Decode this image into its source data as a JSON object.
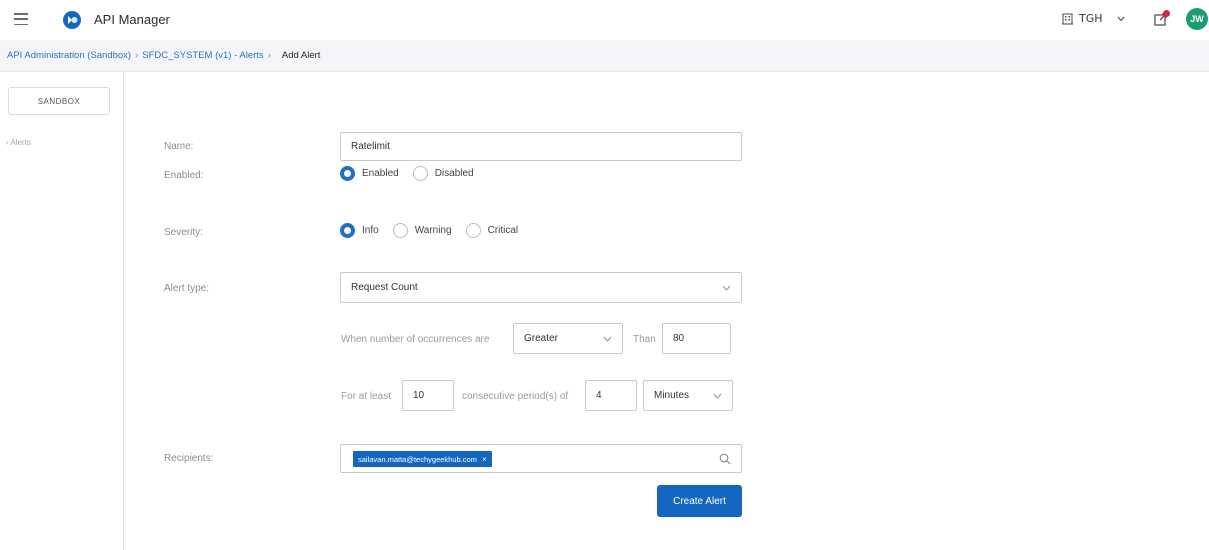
{
  "header": {
    "title": "API Manager",
    "org": "TGH",
    "avatar_initials": "JW",
    "accent_color": "#1566c0",
    "avatar_color": "#1a9e6f",
    "notification_color": "#d8213b"
  },
  "breadcrumb": {
    "items": [
      "API Administration (Sandbox)",
      "SFDC_SYSTEM (v1) - Alerts"
    ],
    "current": "Add Alert"
  },
  "sidebar": {
    "environment": "SANDBOX",
    "items": [
      "Alerts"
    ]
  },
  "form": {
    "name": {
      "label": "Name:",
      "value": "Ratelimit"
    },
    "enabled": {
      "label": "Enabled:",
      "options": [
        "Enabled",
        "Disabled"
      ],
      "selected": "Enabled"
    },
    "severity": {
      "label": "Severity:",
      "options": [
        "Info",
        "Warning",
        "Critical"
      ],
      "selected": "Info"
    },
    "alert_type": {
      "label": "Alert type:",
      "value": "Request Count"
    },
    "condition": {
      "prefix": "When number of occurrences are",
      "operator": "Greater",
      "than_label": "Than",
      "threshold": "80"
    },
    "period": {
      "prefix": "For at least",
      "count": "10",
      "middle": "consecutive period(s) of",
      "length": "4",
      "unit": "Minutes"
    },
    "recipients": {
      "label": "Recipients:",
      "chip": "sailavan.matta@techygeekhub.com"
    },
    "submit_label": "Create Alert"
  }
}
